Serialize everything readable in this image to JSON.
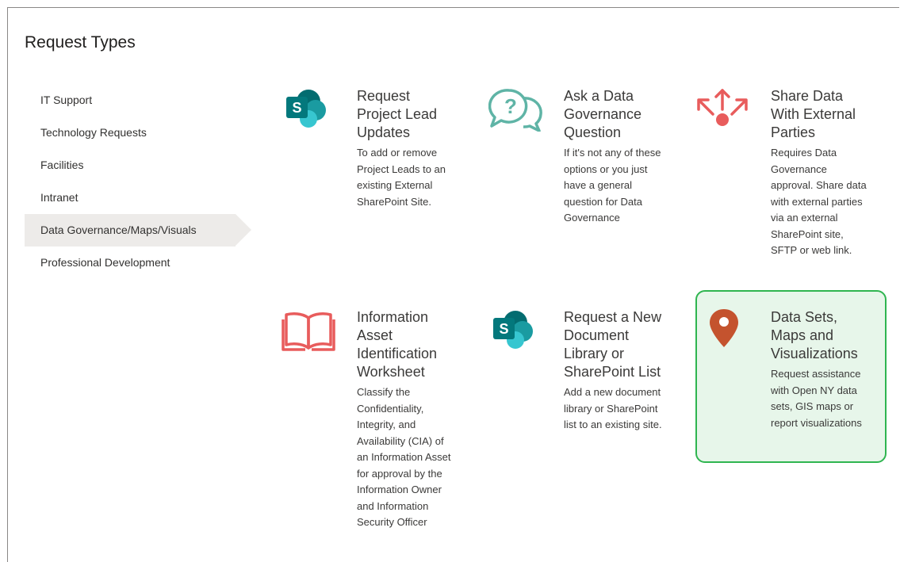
{
  "page": {
    "title": "Request Types"
  },
  "sidebar": {
    "items": [
      {
        "label": "IT Support"
      },
      {
        "label": "Technology Requests"
      },
      {
        "label": "Facilities"
      },
      {
        "label": "Intranet"
      },
      {
        "label": "Data Governance/Maps/Visuals",
        "active": true
      },
      {
        "label": "Professional Development"
      }
    ]
  },
  "cards": [
    {
      "title": "Request Project Lead Updates",
      "description": "To add or remove Project Leads to an existing External SharePoint Site.",
      "icon": "sharepoint-icon"
    },
    {
      "title": "Ask a Data Governance Question",
      "description": "If it's not any of these options or you just have a general question for Data Governance",
      "icon": "question-bubbles-icon"
    },
    {
      "title": "Share Data With External Parties",
      "description": "Requires Data Governance approval. Share data with external parties via an external SharePoint site, SFTP or web link.",
      "icon": "share-arrows-icon"
    },
    {
      "title": "Information Asset Identification Worksheet",
      "description": "Classify the Confidentiality, Integrity, and Availability (CIA) of an Information Asset for approval by the Information Owner and Information Security Officer",
      "icon": "open-book-icon"
    },
    {
      "title": "Request a New Document Library or SharePoint List",
      "description": "Add a new document library or SharePoint list to an existing site.",
      "icon": "sharepoint-icon"
    },
    {
      "title": "Data Sets, Maps and Visualizations",
      "description": "Request assistance with Open NY data sets, GIS maps or report visualizations",
      "icon": "map-pin-icon",
      "selected": true
    }
  ],
  "colors": {
    "selected_border": "#2fb550",
    "selected_background": "#e7f6ea",
    "sharepoint_teal": "#038387",
    "teal_icon": "#5fb4a6",
    "coral_icon": "#e85c5c",
    "pin_orange": "#c4532e"
  }
}
